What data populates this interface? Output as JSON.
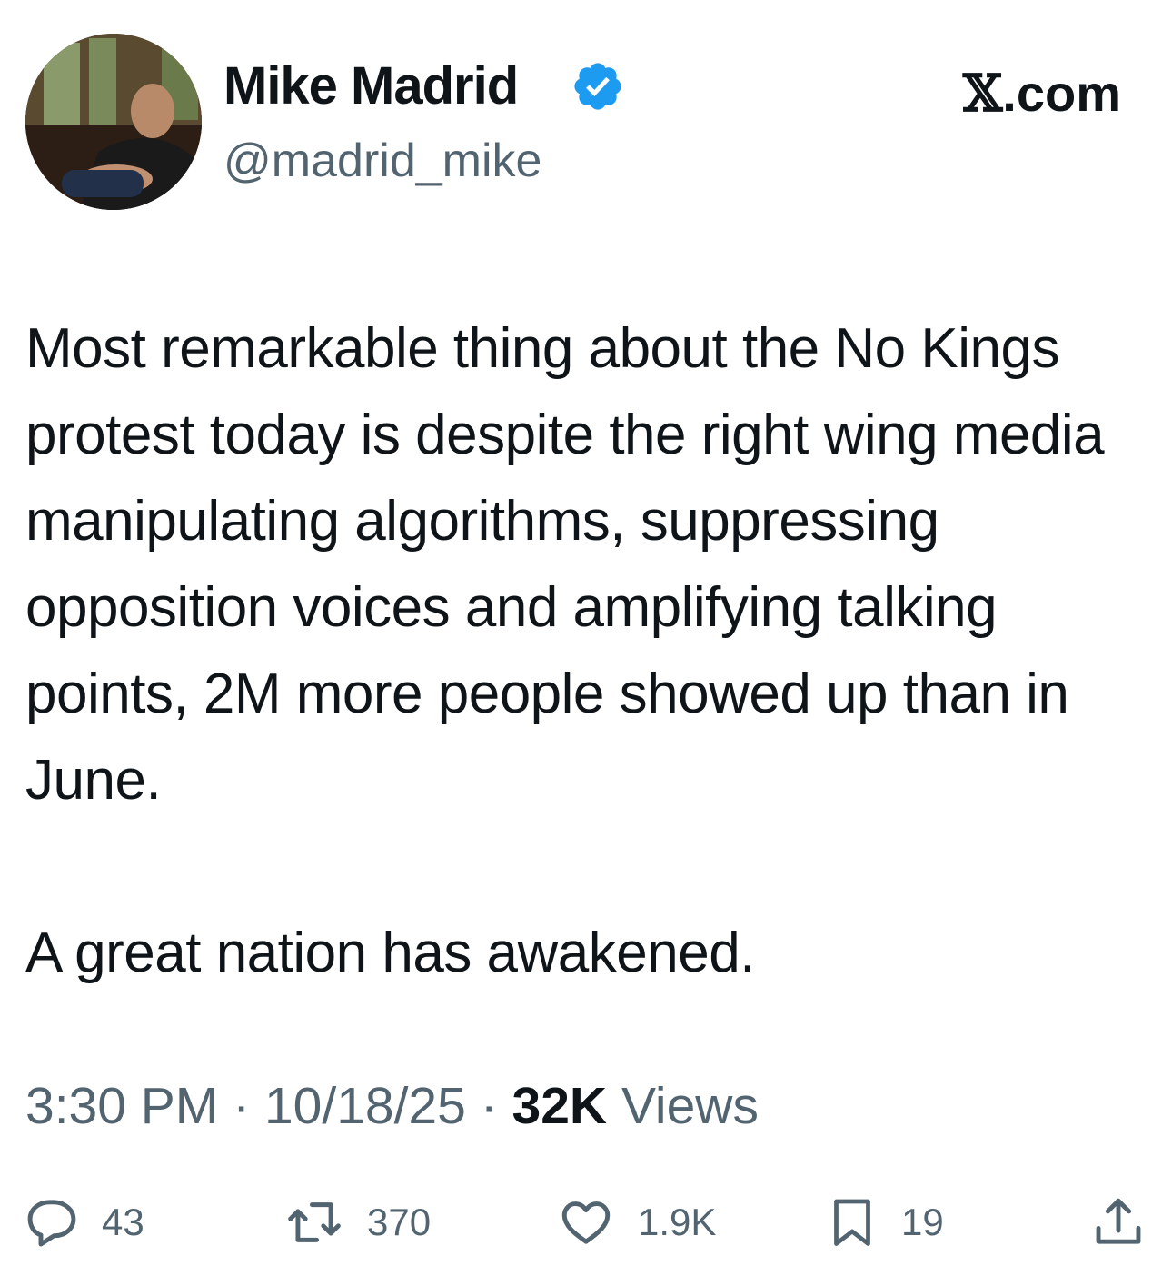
{
  "user": {
    "display_name": "Mike Madrid",
    "handle": "@madrid_mike",
    "verified_icon": "verified-badge-icon",
    "verified_color": "#1d9bf0"
  },
  "source": {
    "logo_icon": "x-logo-icon",
    "x_glyph": "𝕏",
    "domain_suffix": ".com"
  },
  "tweet": {
    "paragraphs": [
      "Most remarkable thing about the No Kings protest today is despite the right wing media manipulating algorithms, suppressing opposition voices and amplifying talking points, 2M more people showed up than in June.",
      "A great nation has awakened."
    ]
  },
  "meta": {
    "time": "3:30 PM",
    "separator": "·",
    "date": "10/18/25",
    "views_count": "32K",
    "views_label": "Views"
  },
  "actions": {
    "replies": {
      "icon": "reply-icon",
      "count": "43"
    },
    "reposts": {
      "icon": "repost-icon",
      "count": "370"
    },
    "likes": {
      "icon": "heart-icon",
      "count": "1.9K"
    },
    "bookmarks": {
      "icon": "bookmark-icon",
      "count": "19"
    },
    "share": {
      "icon": "share-icon"
    }
  },
  "colors": {
    "text_primary": "#0f1419",
    "text_secondary": "#536471",
    "accent": "#1d9bf0",
    "background": "#ffffff"
  }
}
